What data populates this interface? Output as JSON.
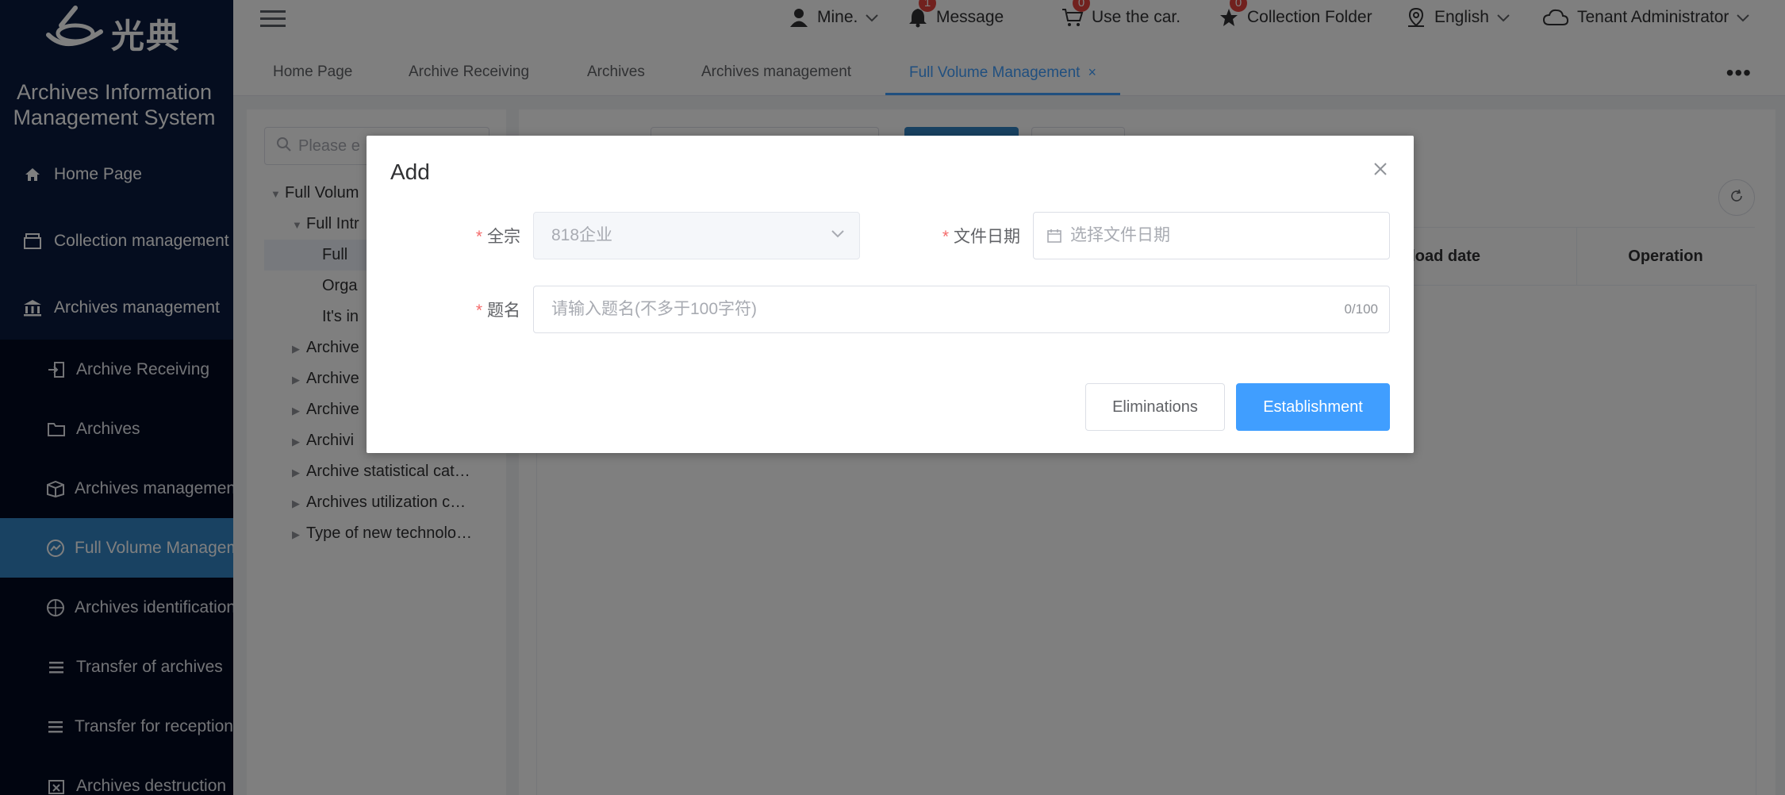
{
  "app": {
    "logo_text": "光典",
    "system_title_line1": "Archives Information",
    "system_title_line2": "Management System"
  },
  "sidebar": {
    "top_items": [
      {
        "label": "Home Page",
        "icon": "home-icon"
      },
      {
        "label": "Collection management",
        "icon": "box-icon"
      },
      {
        "label": "Archives management",
        "icon": "bank-icon"
      }
    ],
    "sub_items": [
      {
        "label": "Archive Receiving",
        "icon": "receive-icon"
      },
      {
        "label": "Archives",
        "icon": "folder-icon"
      },
      {
        "label": "Archives management",
        "icon": "package-icon"
      },
      {
        "label": "Full Volume Management",
        "icon": "dashboard-icon",
        "active": true
      },
      {
        "label": "Archives identification",
        "icon": "compass-icon"
      },
      {
        "label": "Transfer of archives",
        "icon": "list-icon"
      },
      {
        "label": "Transfer for reception",
        "icon": "list-icon"
      },
      {
        "label": "Archives destruction",
        "icon": "destroy-icon"
      }
    ]
  },
  "header": {
    "mine_label": "Mine.",
    "message_label": "Message",
    "message_badge": "1",
    "car_label": "Use the car.",
    "car_badge": "0",
    "collection_label": "Collection Folder",
    "collection_badge": "0",
    "language_label": "English",
    "tenant_label": "Tenant Administrator"
  },
  "tabs": [
    {
      "label": "Home Page"
    },
    {
      "label": "Archive Receiving"
    },
    {
      "label": "Archives"
    },
    {
      "label": "Archives management"
    },
    {
      "label": "Full Volume Management",
      "active": true,
      "close": "×"
    }
  ],
  "tree": {
    "search_placeholder": "Please e",
    "nodes": [
      {
        "label": "Full Volum",
        "arrow": "▼"
      },
      {
        "label": "Full Intr",
        "arrow": "▼"
      },
      {
        "label": "Full",
        "arrow": ""
      },
      {
        "label": "Orga",
        "arrow": ""
      },
      {
        "label": "It's in",
        "arrow": ""
      },
      {
        "label": "Archive",
        "arrow": "▶"
      },
      {
        "label": "Archive",
        "arrow": "▶"
      },
      {
        "label": "Archive",
        "arrow": "▶"
      },
      {
        "label": "Archivi",
        "arrow": "▶"
      },
      {
        "label": "Archive statistical cat…",
        "arrow": "▶"
      },
      {
        "label": "Archives utilization c…",
        "arrow": "▶"
      },
      {
        "label": "Type of new technolo…",
        "arrow": "▶"
      }
    ]
  },
  "table": {
    "col_upload_date": "pload date",
    "col_operation": "Operation"
  },
  "dialog": {
    "title": "Add",
    "field_fonds_label": "全宗",
    "field_fonds_value": "818企业",
    "field_date_label": "文件日期",
    "field_date_placeholder": "选择文件日期",
    "field_title_label": "题名",
    "field_title_placeholder": "请输入题名(不多于100字符)",
    "field_title_counter": "0/100",
    "required_mark": "*",
    "cancel_label": "Eliminations",
    "confirm_label": "Establishment"
  },
  "colors": {
    "sidebar_bg": "#0a1a3e",
    "submenu_bg": "#020b20",
    "active_menu": "#3384c4",
    "primary": "#409eff",
    "badge": "#e2433d",
    "required": "#f56c6c"
  }
}
